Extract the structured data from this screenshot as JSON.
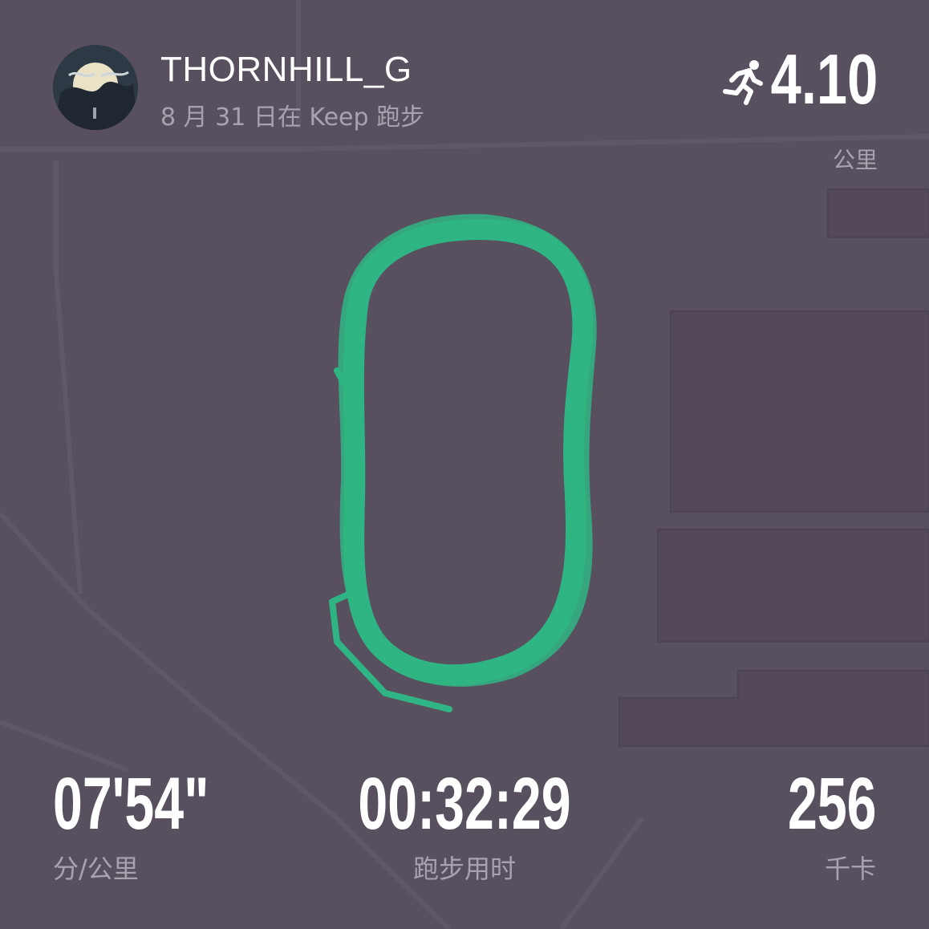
{
  "user": {
    "name": "THORNHILL_G",
    "activity_line": "8 月 31 日在 Keep 跑步"
  },
  "distance": {
    "value": "4.10",
    "unit": "公里"
  },
  "stats": {
    "pace": {
      "value": "07'54\"",
      "label": "分/公里"
    },
    "duration": {
      "value": "00:32:29",
      "label": "跑步用时"
    },
    "calories": {
      "value": "256",
      "label": "千卡"
    }
  },
  "icons": {
    "activity": "running-person-icon"
  },
  "colors": {
    "background": "#58505f",
    "route": "#2fb583",
    "muted_text": "#a9a2ae"
  }
}
